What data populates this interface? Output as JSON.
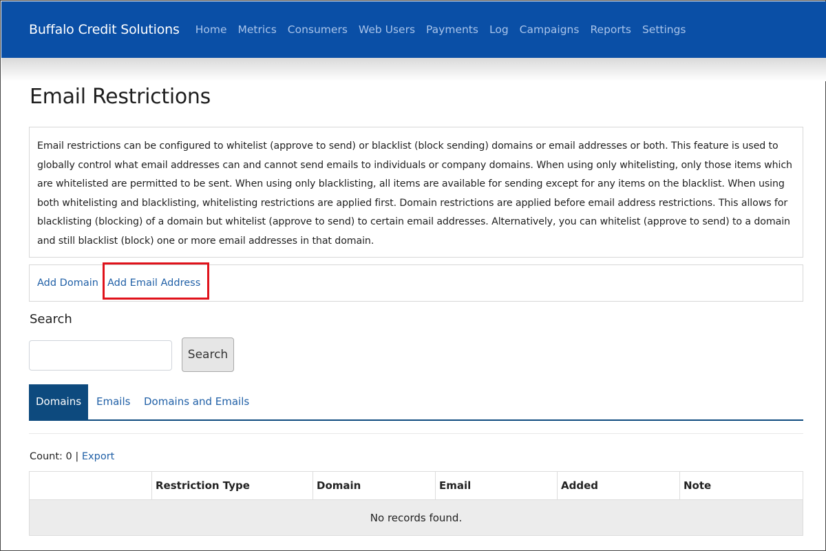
{
  "navbar": {
    "brand": "Buffalo Credit Solutions",
    "items": [
      "Home",
      "Metrics",
      "Consumers",
      "Web Users",
      "Payments",
      "Log",
      "Campaigns",
      "Reports",
      "Settings"
    ]
  },
  "page": {
    "title": "Email Restrictions",
    "description": "Email restrictions can be configured to whitelist (approve to send) or blacklist (block sending) domains or email addresses or both. This feature is used to globally control what email addresses can and cannot send emails to individuals or company domains. When using only whitelisting, only those items which are whitelisted are permitted to be sent. When using only blacklisting, all items are available for sending except for any items on the blacklist. When using both whitelisting and blacklisting, whitelisting restrictions are applied first. Domain restrictions are applied before email address restrictions. This allows for blacklisting (blocking) of a domain but whitelist (approve to send) to certain email addresses. Alternatively, you can whitelist (approve to send) to a domain and still blacklist (block) one or more email addresses in that domain."
  },
  "actions": {
    "add_domain": "Add Domain",
    "add_email": "Add Email Address"
  },
  "search": {
    "label": "Search",
    "value": "",
    "placeholder": "",
    "button": "Search"
  },
  "tabs": [
    {
      "label": "Domains",
      "active": true
    },
    {
      "label": "Emails",
      "active": false
    },
    {
      "label": "Domains and Emails",
      "active": false
    }
  ],
  "results": {
    "count_label": "Count: 0",
    "separator": " | ",
    "export": "Export"
  },
  "table": {
    "columns": [
      "",
      "Restriction Type",
      "Domain",
      "Email",
      "Added",
      "Note"
    ],
    "empty_message": "No records found."
  },
  "colors": {
    "navbar": "#0a4fa6",
    "active_tab": "#0d4a7e",
    "link": "#1f5fa6",
    "highlight": "#e0121b"
  }
}
